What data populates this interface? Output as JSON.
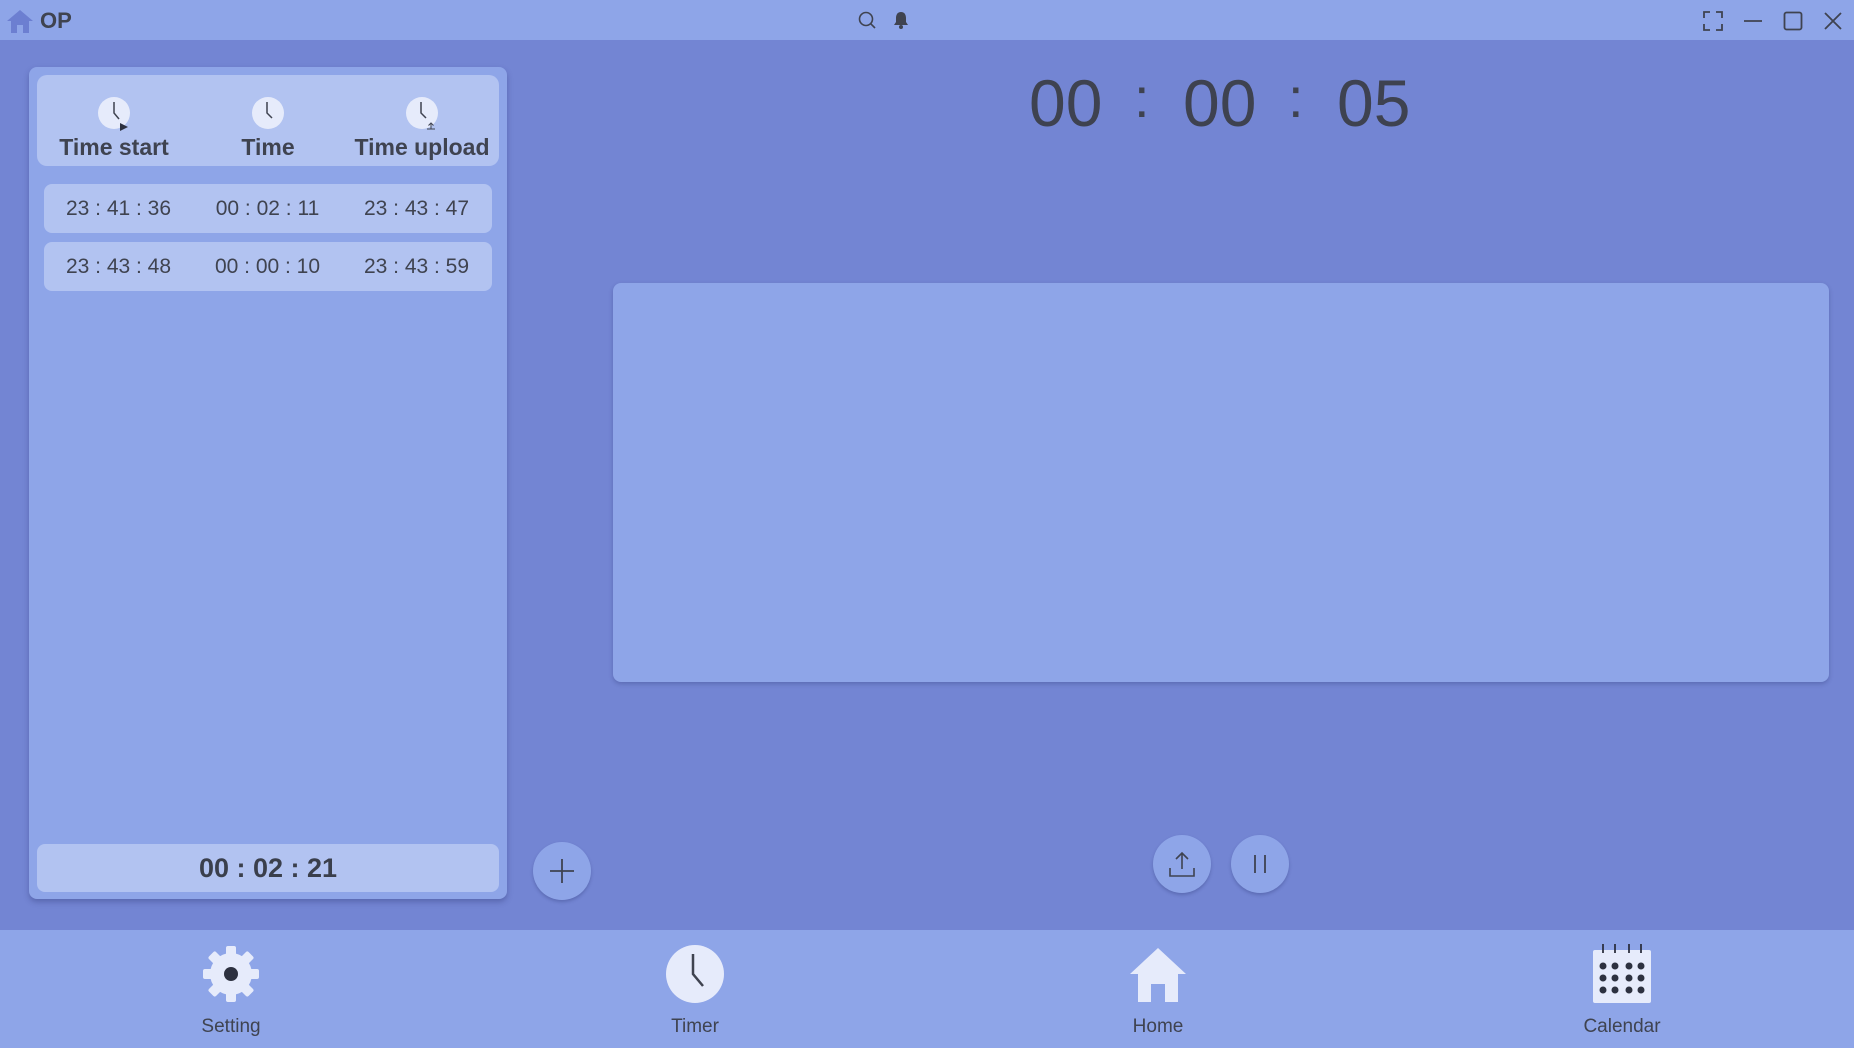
{
  "titlebar": {
    "title": "OP",
    "icons": [
      "home-icon",
      "search-icon",
      "bell-icon",
      "fullscreen-icon",
      "minimize-icon",
      "maximize-icon",
      "close-icon"
    ]
  },
  "left_panel": {
    "columns": [
      {
        "label": "Time start",
        "icon": "clock-play-icon"
      },
      {
        "label": "Time",
        "icon": "clock-icon"
      },
      {
        "label": "Time upload",
        "icon": "clock-upload-icon"
      }
    ],
    "rows": [
      [
        "23 : 41 : 36",
        "00 : 02 : 11",
        "23 : 43 : 47"
      ],
      [
        "23 : 43 : 48",
        "00 : 00 : 10",
        "23 : 43 : 59"
      ]
    ],
    "total": "00 : 02 : 21"
  },
  "timer": {
    "hours": "00",
    "minutes": "00",
    "seconds": "05",
    "separator": ":"
  },
  "controls": {
    "add_icon": "plus-icon",
    "upload_icon": "upload-icon",
    "pause_icon": "pause-icon"
  },
  "bottom_nav": [
    {
      "label": "Setting",
      "icon": "gear-icon"
    },
    {
      "label": "Timer",
      "icon": "clock-icon"
    },
    {
      "label": "Home",
      "icon": "home-icon"
    },
    {
      "label": "Calendar",
      "icon": "calendar-icon"
    }
  ],
  "colors": {
    "background": "#7385d3",
    "panel": "#8ea5e8",
    "card_light": "#b2c3f1",
    "text": "#3f4350"
  }
}
